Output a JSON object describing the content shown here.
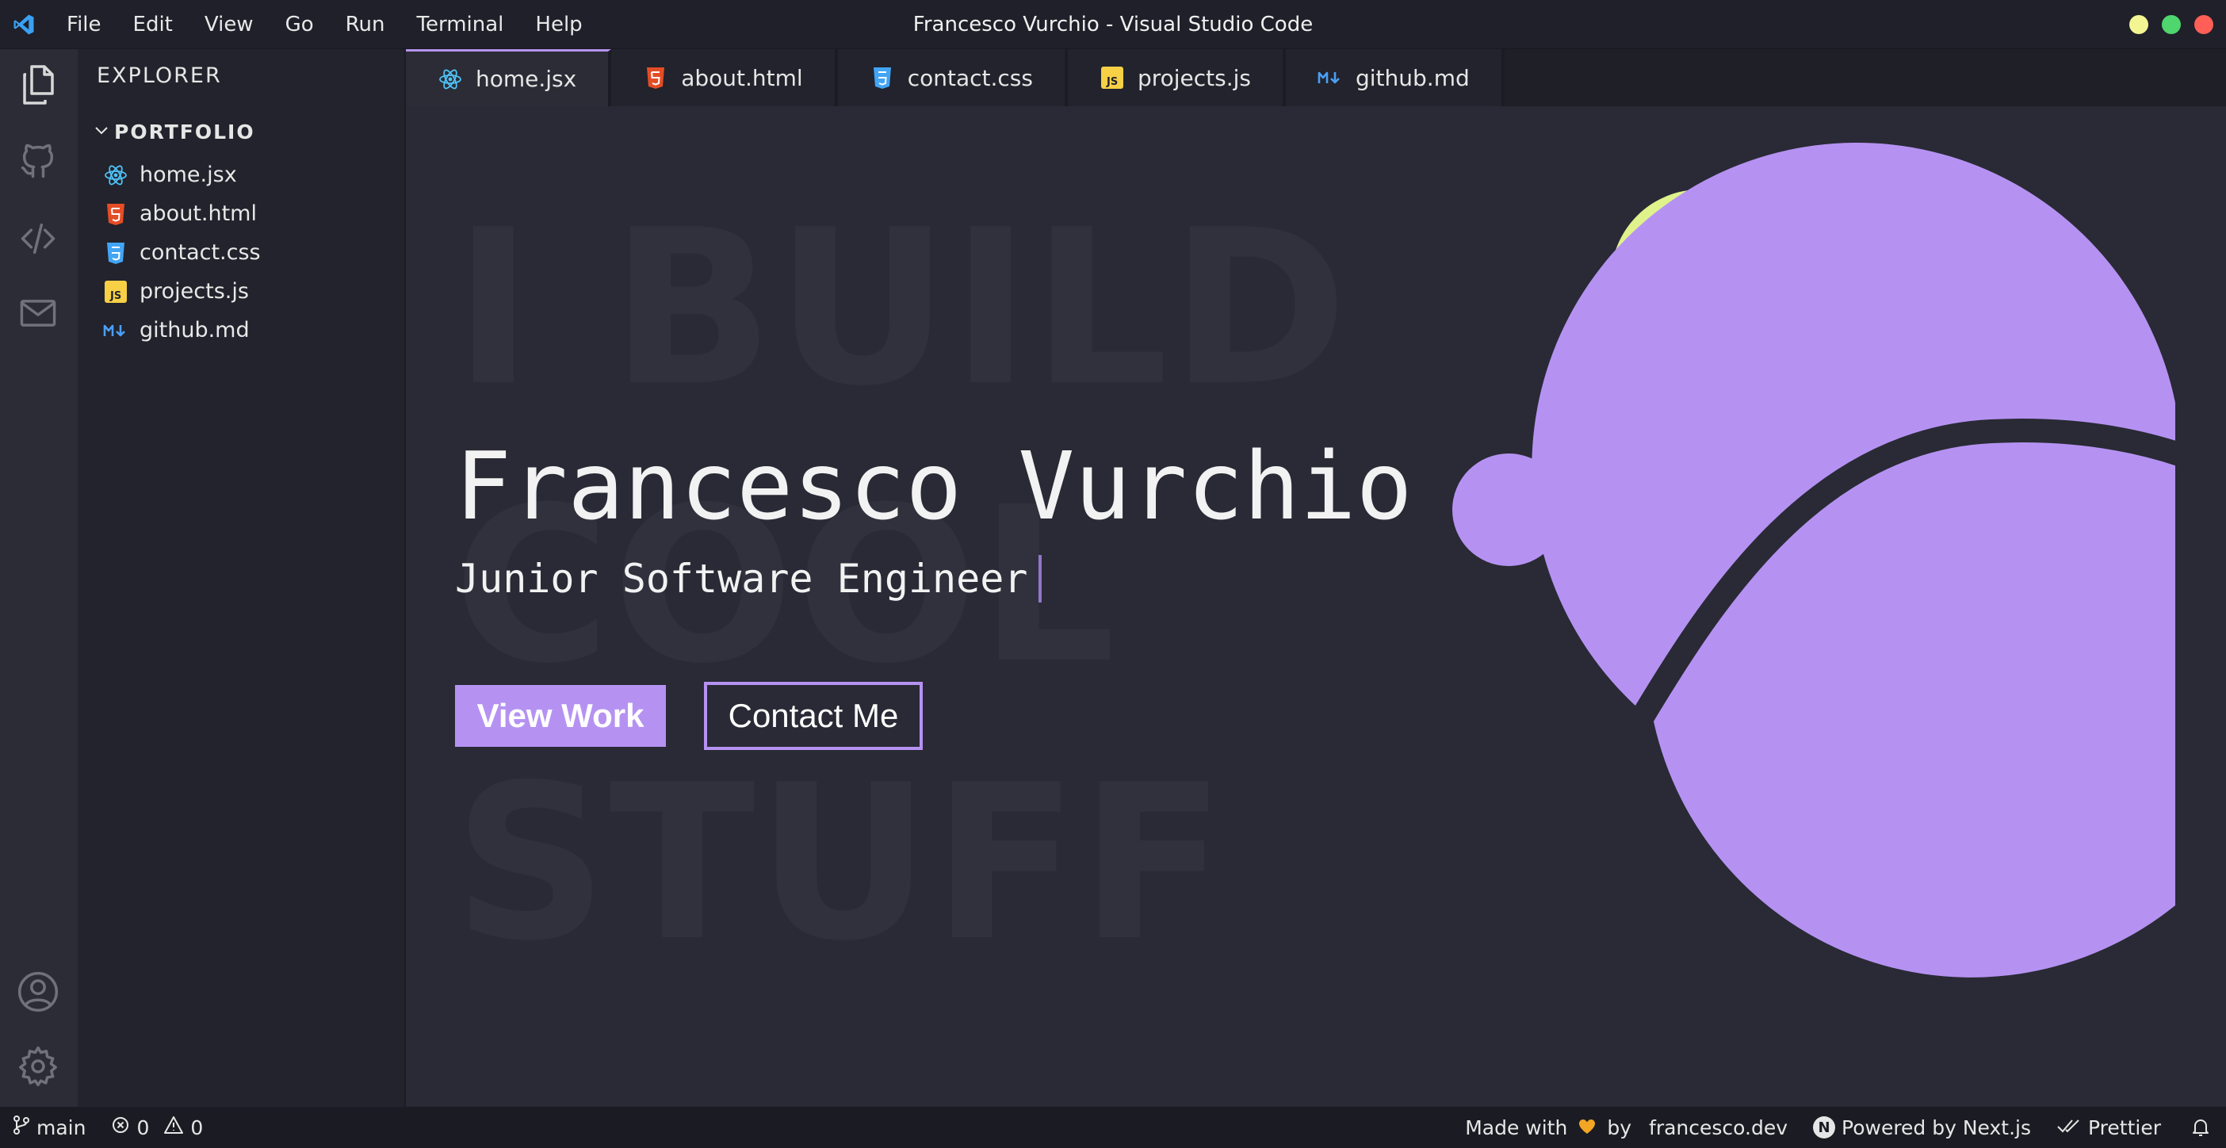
{
  "window": {
    "title": "Francesco Vurchio - Visual Studio Code",
    "menu": [
      "File",
      "Edit",
      "View",
      "Go",
      "Run",
      "Terminal",
      "Help"
    ],
    "traffic_colors": [
      "#f3f593",
      "#4fd66f",
      "#ff5f57"
    ]
  },
  "activity_bar": {
    "items": [
      "explorer-icon",
      "github-icon",
      "code-icon",
      "mail-icon"
    ],
    "bottom_items": [
      "account-icon",
      "settings-icon"
    ]
  },
  "sidebar": {
    "title": "EXPLORER",
    "folder": "PORTFOLIO",
    "files": [
      {
        "name": "home.jsx",
        "icon": "react-icon",
        "color": "#4fc3f7"
      },
      {
        "name": "about.html",
        "icon": "html5-icon",
        "color": "#e44d26"
      },
      {
        "name": "contact.css",
        "icon": "css3-icon",
        "color": "#42a5f5"
      },
      {
        "name": "projects.js",
        "icon": "javascript-icon",
        "color": "#f7d046"
      },
      {
        "name": "github.md",
        "icon": "markdown-icon",
        "color": "#4a9ff5"
      }
    ]
  },
  "tabs": [
    {
      "label": "home.jsx",
      "icon": "react-icon",
      "active": true
    },
    {
      "label": "about.html",
      "icon": "html5-icon",
      "active": false
    },
    {
      "label": "contact.css",
      "icon": "css3-icon",
      "active": false
    },
    {
      "label": "projects.js",
      "icon": "javascript-icon",
      "active": false
    },
    {
      "label": "github.md",
      "icon": "markdown-icon",
      "active": false
    }
  ],
  "hero": {
    "background_words": [
      "I BUILD",
      "COOL",
      "STUFF"
    ],
    "name": "Francesco Vurchio",
    "role": "Junior Software Engineer",
    "primary_button": "View Work",
    "secondary_button": "Contact Me",
    "accent_color": "#b592f2",
    "lime_color": "#dff28c"
  },
  "statusbar": {
    "branch": "main",
    "errors": "0",
    "warnings": "0",
    "made_with": "Made with",
    "by": "by",
    "site": "francesco.dev",
    "powered_by": "Powered by Next.js",
    "n_logo": "N",
    "prettier": "Prettier",
    "heart_color": "#f3a623"
  }
}
